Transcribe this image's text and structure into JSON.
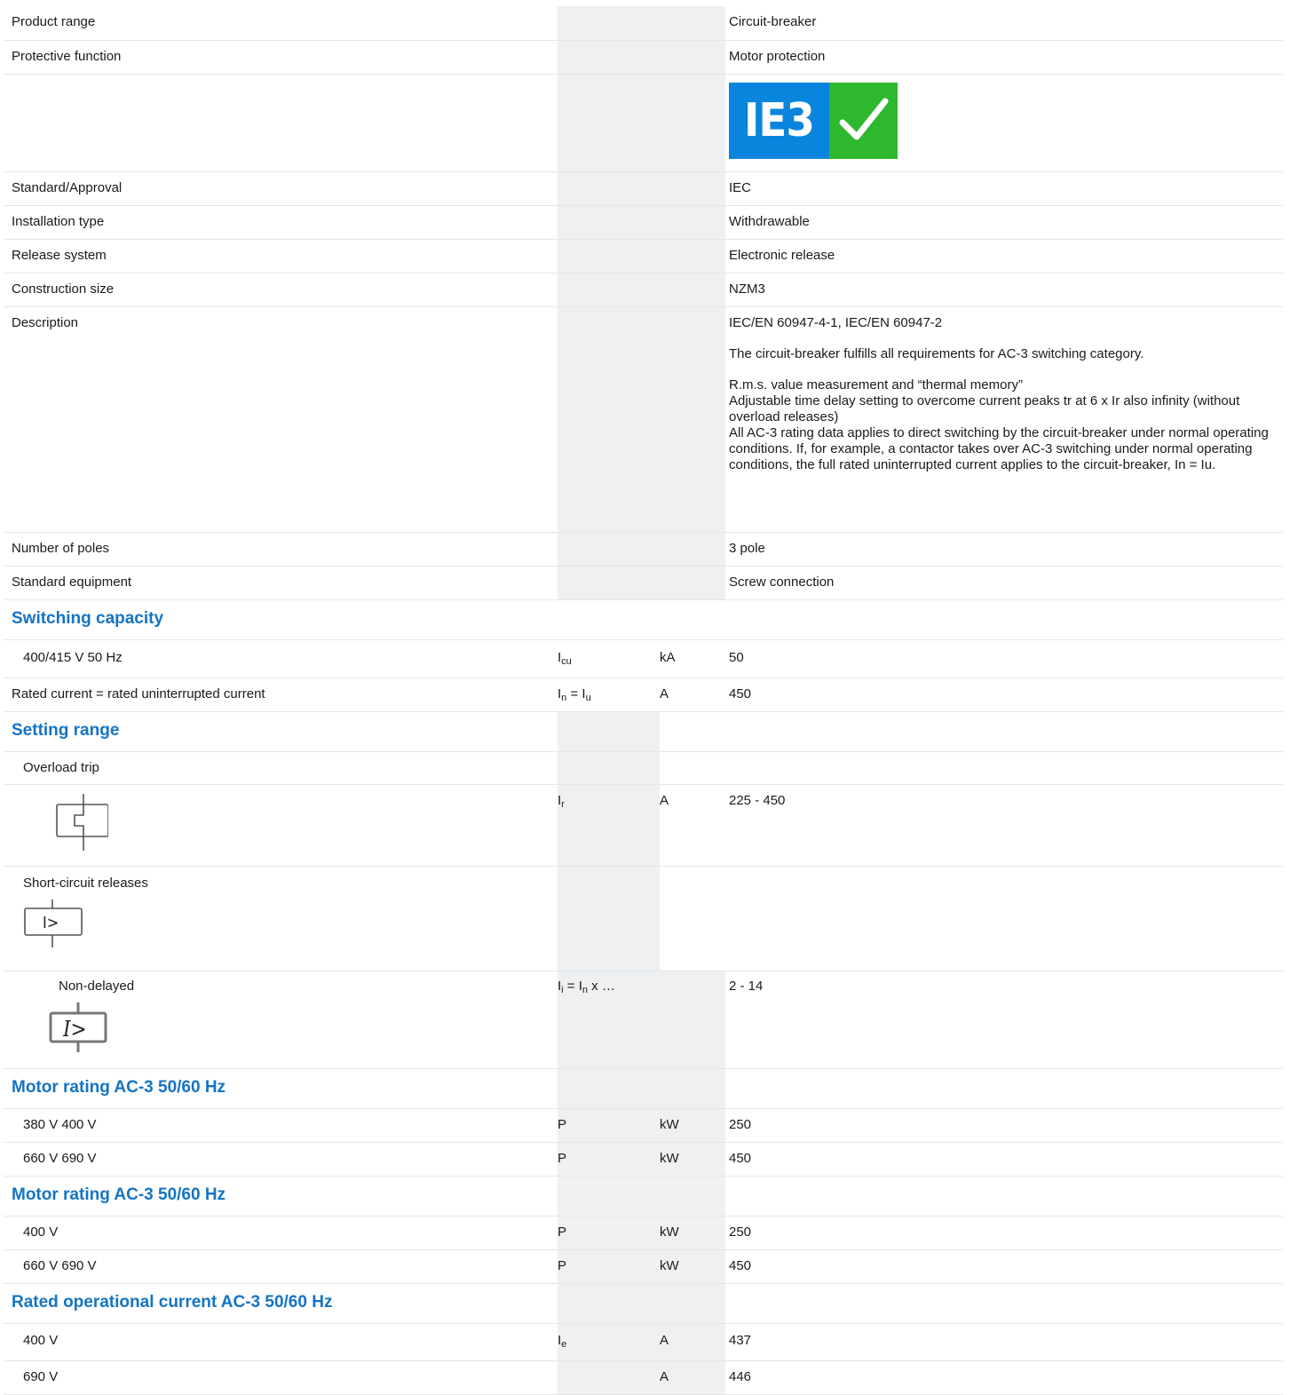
{
  "rows": [
    {
      "label": "Product range",
      "value": "Circuit-breaker"
    },
    {
      "label": "Protective function",
      "value": "Motor protection"
    },
    {
      "label": "Standard/Approval",
      "value": "IEC"
    },
    {
      "label": "Installation type",
      "value": "Withdrawable"
    },
    {
      "label": "Release system",
      "value": "Electronic release"
    },
    {
      "label": "Construction size",
      "value": "NZM3"
    },
    {
      "label": "Number of poles",
      "value": "3 pole"
    },
    {
      "label": "Standard equipment",
      "value": "Screw connection"
    }
  ],
  "ie3_badge": {
    "text": "IE3",
    "icon": "checkmark-icon",
    "blue": "#0a85dd",
    "green": "#2db82d"
  },
  "description": {
    "label": "Description",
    "para1": "IEC/EN 60947-4-1, IEC/EN 60947-2",
    "para2": "The circuit-breaker fulfills all requirements for AC-3 switching category.",
    "para3": "R.m.s. value measurement and “thermal memory”\nAdjustable time delay setting to overcome current peaks tr at 6 x Ir also infinity (without overload releases)\nAll AC-3 rating data applies to direct switching by the circuit-breaker under normal operating conditions. If, for example, a contactor takes over AC-3 switching under normal operating conditions, the full rated uninterrupted current applies to the circuit-breaker, In = Iu."
  },
  "switching_capacity": {
    "title": "Switching capacity",
    "row": {
      "label": "400/415 V 50 Hz",
      "sym": "I",
      "sym_sub": "cu",
      "unit": "kA",
      "value": "50"
    }
  },
  "rated_current": {
    "label": "Rated current = rated uninterrupted current",
    "sym_a": "I",
    "sub_a": "n",
    "sym_mid": " = I",
    "sub_b": "u",
    "unit": "A",
    "value": "450"
  },
  "setting_range": {
    "title": "Setting range",
    "overload": {
      "label": "Overload trip",
      "sym": "I",
      "sym_sub": "r",
      "unit": "A",
      "value": "225 - 450",
      "icon": "overload-release-icon"
    },
    "short_circuit": {
      "label": "Short-circuit releases",
      "icon_text": "I>",
      "icon": "short-circuit-release-icon"
    },
    "non_delayed": {
      "label": "Non-delayed",
      "sym_a": "I",
      "sub_a": "i",
      "sym_mid": " = I",
      "sub_b": "n",
      "sym_tail": " x …",
      "value": "2 - 14",
      "icon_text": "I>",
      "icon": "instantaneous-release-icon"
    }
  },
  "motor_rating_1": {
    "title": "Motor rating AC-3 50/60 Hz",
    "rows": [
      {
        "label": "380 V 400 V",
        "sym": "P",
        "unit": "kW",
        "value": "250"
      },
      {
        "label": "660 V 690 V",
        "sym": "P",
        "unit": "kW",
        "value": "450"
      }
    ]
  },
  "motor_rating_2": {
    "title": "Motor rating AC-3 50/60 Hz",
    "rows": [
      {
        "label": "400 V",
        "sym": "P",
        "unit": "kW",
        "value": "250"
      },
      {
        "label": "660 V 690 V",
        "sym": "P",
        "unit": "kW",
        "value": "450"
      }
    ]
  },
  "rated_operational_current": {
    "title": "Rated operational current AC-3 50/60 Hz",
    "rows": [
      {
        "label": "400 V",
        "sym": "I",
        "sym_sub": "e",
        "unit": "A",
        "value": "437"
      },
      {
        "label": "690 V",
        "sym": "",
        "sym_sub": "",
        "unit": "A",
        "value": "446"
      }
    ]
  }
}
